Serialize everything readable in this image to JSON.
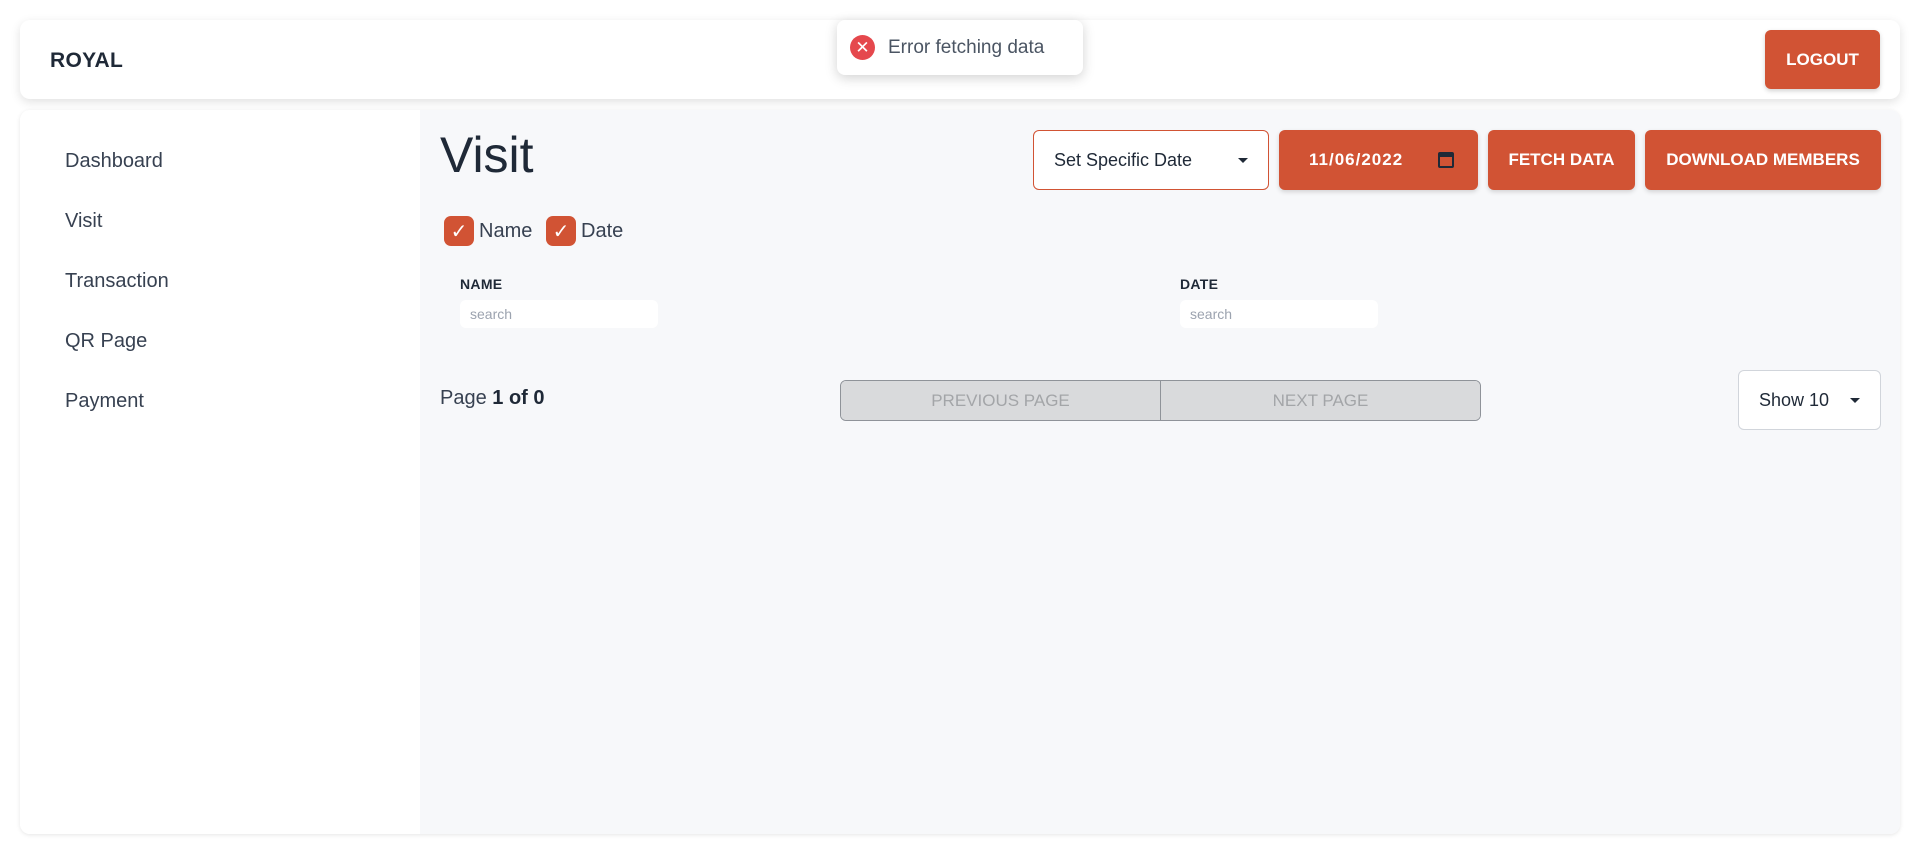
{
  "header": {
    "brand": "ROYAL",
    "logout_label": "LOGOUT"
  },
  "toast": {
    "icon": "error-x-icon",
    "message": "Error fetching data"
  },
  "sidebar": {
    "items": [
      {
        "label": "Dashboard"
      },
      {
        "label": "Visit"
      },
      {
        "label": "Transaction"
      },
      {
        "label": "QR Page"
      },
      {
        "label": "Payment"
      }
    ]
  },
  "main": {
    "title": "Visit",
    "date_mode": {
      "selected": "Set Specific Date"
    },
    "date_value": "11/06/2022",
    "fetch_label": "FETCH DATA",
    "download_label": "DOWNLOAD MEMBERS",
    "column_toggles": [
      {
        "label": "Name",
        "checked": true
      },
      {
        "label": "Date",
        "checked": true
      }
    ],
    "columns": [
      {
        "header": "NAME",
        "placeholder": "search",
        "value": ""
      },
      {
        "header": "DATE",
        "placeholder": "search",
        "value": ""
      }
    ],
    "pagination": {
      "page_label": "Page",
      "page_count": "1 of 0",
      "previous_label": "PREVIOUS PAGE",
      "next_label": "NEXT PAGE",
      "page_size": "Show 10"
    }
  },
  "colors": {
    "accent": "#d15334",
    "error": "#e5484d",
    "main_bg": "#f7f8fa",
    "disabled_bg": "#d9dadc"
  }
}
